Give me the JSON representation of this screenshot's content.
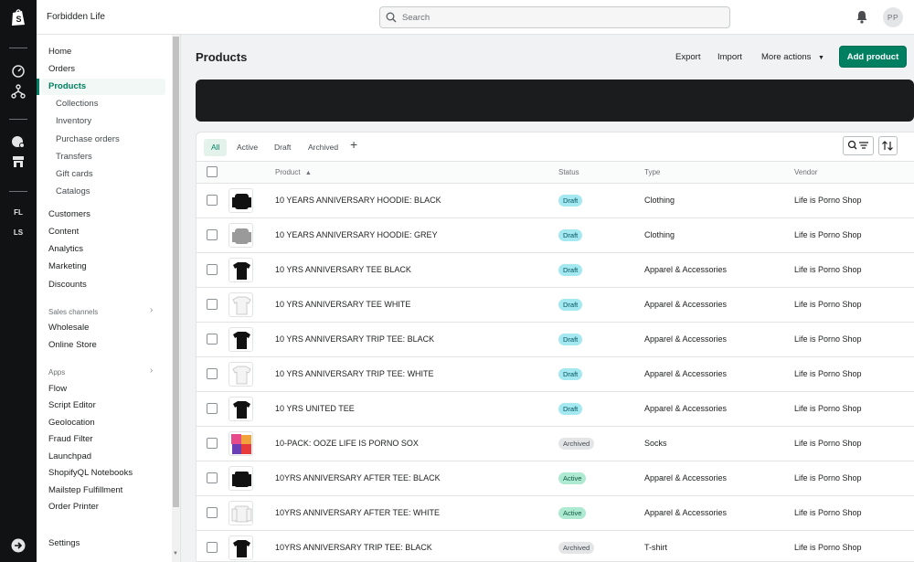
{
  "topbar": {
    "store_name": "Forbidden Life",
    "search_placeholder": "Search",
    "avatar_initials": "PP"
  },
  "rail": {
    "items": [
      "FL",
      "LS"
    ]
  },
  "sidebar": {
    "items": [
      {
        "label": "Home"
      },
      {
        "label": "Orders"
      },
      {
        "label": "Products"
      },
      {
        "label": "Collections"
      },
      {
        "label": "Inventory"
      },
      {
        "label": "Purchase orders"
      },
      {
        "label": "Transfers"
      },
      {
        "label": "Gift cards"
      },
      {
        "label": "Catalogs"
      },
      {
        "label": "Customers"
      },
      {
        "label": "Content"
      },
      {
        "label": "Analytics"
      },
      {
        "label": "Marketing"
      },
      {
        "label": "Discounts"
      }
    ],
    "sales_channels_heading": "Sales channels",
    "sales_channels": [
      "Wholesale",
      "Online Store"
    ],
    "apps_heading": "Apps",
    "apps": [
      "Flow",
      "Script Editor",
      "Geolocation",
      "Fraud Filter",
      "Launchpad",
      "ShopifyQL Notebooks",
      "Mailstep Fulfillment",
      "Order Printer"
    ],
    "settings": "Settings"
  },
  "page": {
    "title": "Products",
    "export": "Export",
    "import": "Import",
    "more_actions": "More actions",
    "add_product": "Add product"
  },
  "tabs": [
    "All",
    "Active",
    "Draft",
    "Archived"
  ],
  "table": {
    "headers": {
      "product": "Product",
      "status": "Status",
      "type": "Type",
      "vendor": "Vendor"
    },
    "rows": [
      {
        "name": "10 YEARS ANNIVERSARY HOODIE: BLACK",
        "status": "Draft",
        "type": "Clothing",
        "vendor": "Life is Porno Shop"
      },
      {
        "name": "10 YEARS ANNIVERSARY HOODIE: GREY",
        "status": "Draft",
        "type": "Clothing",
        "vendor": "Life is Porno Shop"
      },
      {
        "name": "10 YRS ANNIVERSARY TEE BLACK",
        "status": "Draft",
        "type": "Apparel & Accessories",
        "vendor": "Life is Porno Shop"
      },
      {
        "name": "10 YRS ANNIVERSARY TEE WHITE",
        "status": "Draft",
        "type": "Apparel & Accessories",
        "vendor": "Life is Porno Shop"
      },
      {
        "name": "10 YRS ANNIVERSARY TRIP TEE: BLACK",
        "status": "Draft",
        "type": "Apparel & Accessories",
        "vendor": "Life is Porno Shop"
      },
      {
        "name": "10 YRS ANNIVERSARY TRIP TEE: WHITE",
        "status": "Draft",
        "type": "Apparel & Accessories",
        "vendor": "Life is Porno Shop"
      },
      {
        "name": "10 YRS UNITED TEE",
        "status": "Draft",
        "type": "Apparel & Accessories",
        "vendor": "Life is Porno Shop"
      },
      {
        "name": "10-PACK: OOZE LIFE IS PORNO SOX",
        "status": "Archived",
        "type": "Socks",
        "vendor": "Life is Porno Shop"
      },
      {
        "name": "10YRS ANNIVERSARY AFTER TEE: BLACK",
        "status": "Active",
        "type": "Apparel & Accessories",
        "vendor": "Life is Porno Shop"
      },
      {
        "name": "10YRS ANNIVERSARY AFTER TEE: WHITE",
        "status": "Active",
        "type": "Apparel & Accessories",
        "vendor": "Life is Porno Shop"
      },
      {
        "name": "10YRS ANNIVERSARY TRIP TEE: BLACK",
        "status": "Archived",
        "type": "T-shirt",
        "vendor": "Life is Porno Shop"
      }
    ]
  }
}
